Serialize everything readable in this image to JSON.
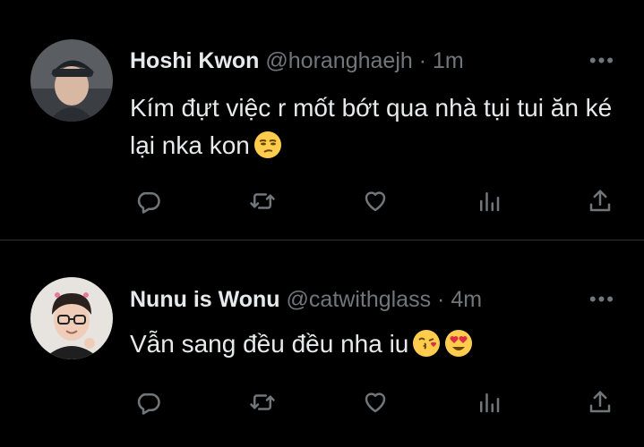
{
  "tweets": [
    {
      "name": "Hoshi Kwon",
      "handle": "@horanghaejh",
      "separator": "·",
      "time": "1m",
      "more": "•••",
      "text": "Kím đựt việc r mốt bớt qua nhà tụi tui ăn ké lại nka kon",
      "emojis": [
        "unamused-face"
      ]
    },
    {
      "name": "Nunu is Wonu",
      "handle": "@catwithglass",
      "separator": "·",
      "time": "4m",
      "more": "•••",
      "text": "Vẫn sang đều đều nha iu",
      "emojis": [
        "face-blowing-kiss",
        "smiling-face-with-heart-eyes"
      ]
    }
  ],
  "icons": [
    "reply-icon",
    "retweet-icon",
    "like-icon",
    "views-icon",
    "share-icon"
  ],
  "colors": {
    "background": "#000000",
    "text": "#e7e9ea",
    "muted": "#71767b",
    "divider": "#2f3336",
    "emoji": "#ffcc4d"
  }
}
